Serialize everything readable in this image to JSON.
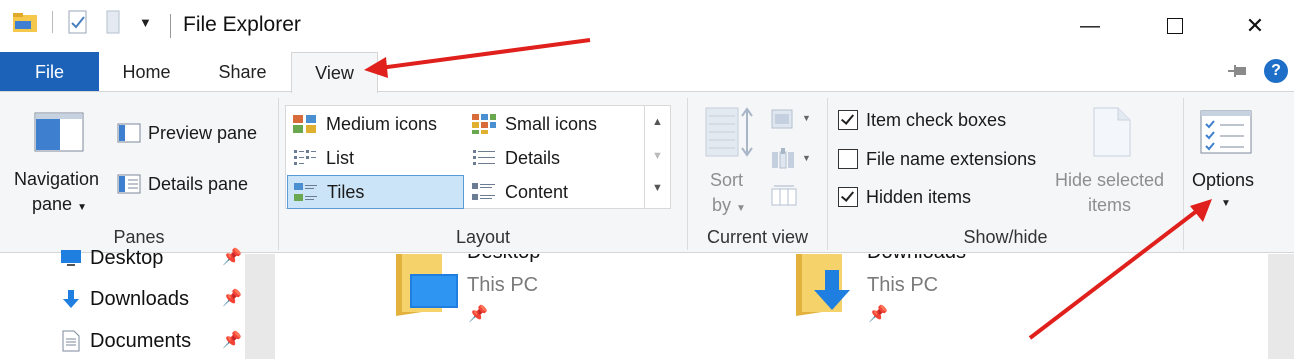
{
  "window": {
    "title": "File Explorer",
    "minimize_glyph": "—",
    "maximize_glyph": "☐",
    "close_glyph": "✕"
  },
  "quick_access_toolbar": {
    "icons": [
      "folder-icon",
      "properties-icon",
      "new-folder-icon",
      "customize-dropdown-icon"
    ]
  },
  "tabs": {
    "file": "File",
    "home": "Home",
    "share": "Share",
    "view": "View",
    "active": "View"
  },
  "ribbon": {
    "panes": {
      "label": "Panes",
      "navigation_pane": "Navigation",
      "navigation_pane_line2": "pane",
      "preview_pane": "Preview pane",
      "details_pane": "Details pane"
    },
    "layout": {
      "label": "Layout",
      "items": [
        "Medium icons",
        "Small icons",
        "List",
        "Details",
        "Tiles",
        "Content"
      ],
      "selected": "Tiles"
    },
    "current_view": {
      "label": "Current view",
      "sort_by": "Sort",
      "sort_by_line2": "by"
    },
    "show_hide": {
      "label": "Show/hide",
      "item_check_boxes": {
        "label": "Item check boxes",
        "checked": true
      },
      "file_name_extensions": {
        "label": "File name extensions",
        "checked": false
      },
      "hidden_items": {
        "label": "Hidden items",
        "checked": true
      },
      "hide_selected_items": "Hide selected",
      "hide_selected_items_line2": "items"
    },
    "options": {
      "label": "Options"
    }
  },
  "navigation_pane": {
    "items": [
      "Desktop",
      "Downloads",
      "Documents"
    ]
  },
  "content": {
    "tiles": [
      {
        "name": "Desktop",
        "location": "This PC"
      },
      {
        "name": "Downloads",
        "location": "This PC"
      }
    ]
  },
  "colors": {
    "accent": "#1b62b8",
    "selection": "#cce4f7",
    "annotation_arrow": "#e0201c",
    "help": "#1f6fc8"
  }
}
